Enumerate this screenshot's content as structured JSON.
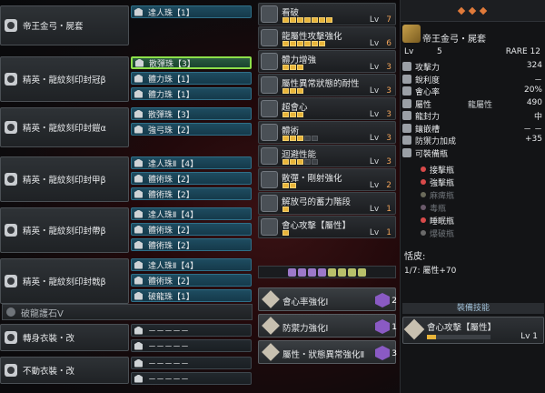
{
  "colors": {
    "slot": "#1e4c60",
    "slot_selected": "#8de04a",
    "pip_on": "#e8b43a",
    "level_max": "#f0a35a"
  },
  "equipment": [
    {
      "name": "帝王金弓・屍套",
      "icon": "weapon-icon",
      "slots": [
        "達人珠【1】"
      ]
    },
    {
      "name": "精英・龍紋刻印封冠β",
      "icon": "helm-icon",
      "slots": [
        "散彈珠【3】",
        "體力珠【1】",
        "體力珠【1】"
      ]
    },
    {
      "name": "精英・龍紋刻印封鎧α",
      "icon": "chest-icon",
      "slots": [
        "散彈珠【3】",
        "強弓珠【2】"
      ]
    },
    {
      "name": "精英・龍紋刻印封甲β",
      "icon": "arms-icon",
      "slots": [
        "達人珠Ⅱ【4】",
        "體術珠【2】",
        "體術珠【2】"
      ]
    },
    {
      "name": "精英・龍紋刻印封帶β",
      "icon": "waist-icon",
      "slots": [
        "達人珠Ⅱ【4】",
        "體術珠【2】",
        "體術珠【2】"
      ]
    },
    {
      "name": "精英・龍紋刻印封戟β",
      "icon": "legs-icon",
      "slots": [
        "達人珠Ⅱ【4】",
        "體術珠【2】",
        "破龍珠【1】"
      ]
    },
    {
      "name": "破龍護石Ⅴ",
      "icon": "charm-icon",
      "slots": []
    },
    {
      "name": "轉身衣裝・改",
      "icon": "mantle-icon",
      "slots": [
        "－－－－－",
        "－－－－－"
      ]
    },
    {
      "name": "不動衣裝・改",
      "icon": "mantle-icon",
      "slots": [
        "－－－－－",
        "－－－－－"
      ]
    }
  ],
  "skills": [
    {
      "name": "看破",
      "level": "Lv",
      "cur": "7",
      "max": 7
    },
    {
      "name": "龍屬性攻擊強化",
      "level": "Lv",
      "cur": "6",
      "max": 6
    },
    {
      "name": "體力增強",
      "level": "Lv",
      "cur": "3",
      "max": 3
    },
    {
      "name": "屬性異常狀態的耐性",
      "level": "Lv",
      "cur": "3",
      "max": 3
    },
    {
      "name": "超會心",
      "level": "Lv",
      "cur": "3",
      "max": 3
    },
    {
      "name": "體術",
      "level": "Lv",
      "cur": "3",
      "max": 5
    },
    {
      "name": "迴避性能",
      "level": "Lv",
      "cur": "3",
      "max": 5
    },
    {
      "name": "散彈・剛射強化",
      "level": "Lv",
      "cur": "2",
      "max": 2
    },
    {
      "name": "解放弓的蓄力階段",
      "level": "Lv",
      "cur": "1",
      "max": 1
    },
    {
      "name": "會心攻擊【屬性】",
      "level": "Lv",
      "cur": "1",
      "max": 1
    }
  ],
  "set_skills": [
    {
      "name": "會心率強化Ⅰ",
      "count": "2"
    },
    {
      "name": "防禦力強化Ⅰ",
      "count": "1"
    },
    {
      "name": "屬性・狀態異常強化Ⅱ",
      "count": "3"
    }
  ],
  "weapon": {
    "name": "帝王金弓・屍套",
    "lv_label": "Lv",
    "lv": "5",
    "rare": "RARE 12",
    "stats": [
      {
        "label": "攻擊力",
        "mid": "",
        "value": "324"
      },
      {
        "label": "銳利度",
        "mid": "",
        "value": "－"
      },
      {
        "label": "會心率",
        "mid": "",
        "value": "20%"
      },
      {
        "label": "屬性",
        "mid": "龍屬性",
        "value": "490"
      },
      {
        "label": "龍封力",
        "mid": "",
        "value": "中"
      },
      {
        "label": "鑲嵌槽",
        "mid": "",
        "value": "－ －"
      },
      {
        "label": "防禦力加成",
        "mid": "",
        "value": "+35"
      },
      {
        "label": "可裝備瓶",
        "mid": "",
        "value": ""
      }
    ],
    "coatings": [
      {
        "name": "接擊瓶",
        "on": true,
        "color": "#d84a4a"
      },
      {
        "name": "強擊瓶",
        "on": true,
        "color": "#d84a4a"
      },
      {
        "name": "麻痺瓶",
        "on": false,
        "color": "#6a6a5a"
      },
      {
        "name": "毒瓶",
        "on": false,
        "color": "#6a5a6a"
      },
      {
        "name": "睡眠瓶",
        "on": true,
        "color": "#d84a4a"
      },
      {
        "name": "爆破瓶",
        "on": false,
        "color": "#6a6a6a"
      }
    ],
    "kinsect_label": "恬皮:",
    "kinsect_value": "1/7: 屬性+70",
    "deco_header": "裝備技能",
    "deco_name": "會心攻擊【屬性】",
    "deco_lv": "Lv 1"
  }
}
